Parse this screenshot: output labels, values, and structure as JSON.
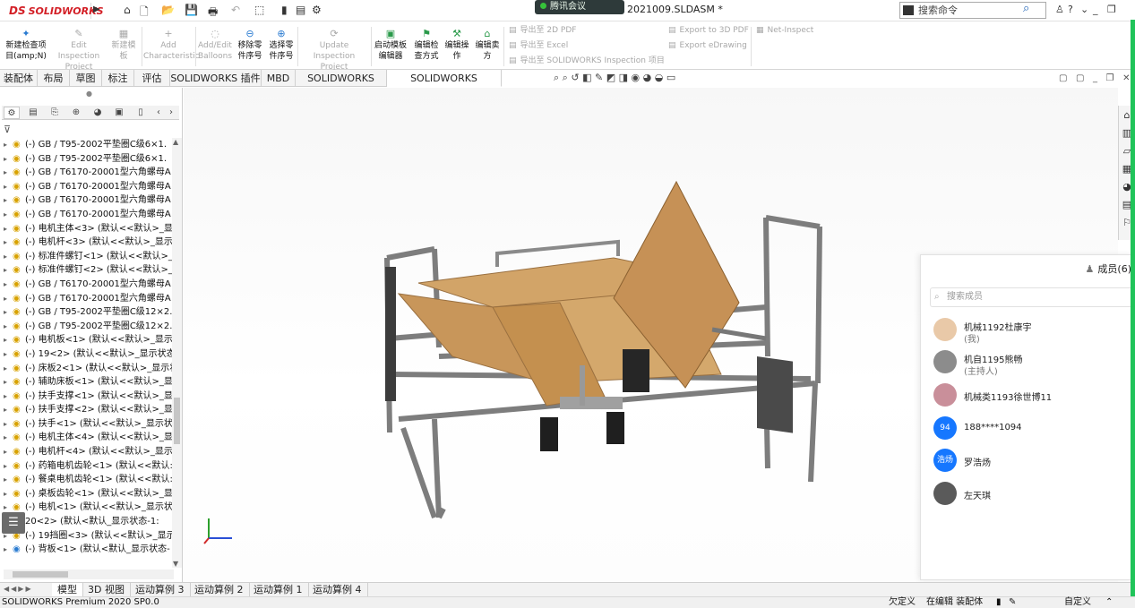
{
  "titlebar": {
    "app_logo_text": "SOLIDWORKS",
    "logo_prefix": "DS",
    "meeting_label": "腾讯会议",
    "document_title": "2021009.SLDASM *",
    "search_placeholder": "搜索命令",
    "help_label": "?"
  },
  "ribbon": {
    "buttons": [
      {
        "label": "新建检查项目(amp;N)",
        "enabled": true
      },
      {
        "label": "Edit Inspection Project",
        "enabled": false
      },
      {
        "label": "新建模板",
        "enabled": false
      },
      {
        "label": "Add Characteristic",
        "enabled": false
      },
      {
        "label": "Add/Edit Balloons",
        "enabled": false
      },
      {
        "label": "移除零件序号",
        "enabled": true
      },
      {
        "label": "选择零件序号",
        "enabled": true
      },
      {
        "label": "Update Inspection Project",
        "enabled": false
      },
      {
        "label": "启动模板编辑器",
        "enabled": true
      },
      {
        "label": "编辑检查方式",
        "enabled": true
      },
      {
        "label": "编辑操作",
        "enabled": true
      },
      {
        "label": "编辑卖方",
        "enabled": true
      }
    ],
    "export_items": [
      "导出至 2D PDF",
      "导出至 Excel",
      "导出至 SOLIDWORKS Inspection 项目",
      "Export to 3D PDF",
      "Export eDrawing",
      "Net-Inspect"
    ]
  },
  "tabs": [
    "装配体",
    "布局",
    "草图",
    "标注",
    "评估",
    "SOLIDWORKS 插件",
    "MBD",
    "SOLIDWORKS CAM",
    "SOLIDWORKS Inspection"
  ],
  "active_tab": "SOLIDWORKS Inspection",
  "tree": [
    {
      "text": "(-) GB / T95-2002平垫圈C级6×1.",
      "icon": "part"
    },
    {
      "text": "(-) GB / T95-2002平垫圈C级6×1.",
      "icon": "part"
    },
    {
      "text": "(-) GB / T6170-20001型六角螺母A",
      "icon": "part"
    },
    {
      "text": "(-) GB / T6170-20001型六角螺母A",
      "icon": "part"
    },
    {
      "text": "(-) GB / T6170-20001型六角螺母A",
      "icon": "part"
    },
    {
      "text": "(-) GB / T6170-20001型六角螺母A",
      "icon": "part"
    },
    {
      "text": "(-) 电机主体<3> (默认<<默认>_显",
      "icon": "part"
    },
    {
      "text": "(-) 电机杆<3> (默认<<默认>_显示",
      "icon": "part"
    },
    {
      "text": "(-) 标准件螺钉<1> (默认<<默认>_",
      "icon": "part"
    },
    {
      "text": "(-) 标准件螺钉<2> (默认<<默认>_",
      "icon": "part"
    },
    {
      "text": "(-) GB / T6170-20001型六角螺母A",
      "icon": "part"
    },
    {
      "text": "(-) GB / T6170-20001型六角螺母A",
      "icon": "part"
    },
    {
      "text": "(-) GB / T95-2002平垫圈C级12×2.",
      "icon": "part"
    },
    {
      "text": "(-) GB / T95-2002平垫圈C级12×2.",
      "icon": "part"
    },
    {
      "text": "(-) 电机板<1> (默认<<默认>_显示",
      "icon": "part"
    },
    {
      "text": "(-) 19<2> (默认<<默认>_显示状态",
      "icon": "part"
    },
    {
      "text": "(-) 床板2<1> (默认<<默认>_显示状",
      "icon": "part"
    },
    {
      "text": "(-) 辅助床板<1> (默认<<默认>_显",
      "icon": "part"
    },
    {
      "text": "(-) 扶手支撑<1> (默认<<默认>_显",
      "icon": "part"
    },
    {
      "text": "(-) 扶手支撑<2> (默认<<默认>_显",
      "icon": "part"
    },
    {
      "text": "(-) 扶手<1> (默认<<默认>_显示状",
      "icon": "part"
    },
    {
      "text": "(-) 电机主体<4> (默认<<默认>_显",
      "icon": "part"
    },
    {
      "text": "(-) 电机杆<4> (默认<<默认>_显示",
      "icon": "part"
    },
    {
      "text": "(-) 药箱电机齿轮<1> (默认<<默认:",
      "icon": "part"
    },
    {
      "text": "(-) 餐桌电机齿轮<1> (默认<<默认:",
      "icon": "part"
    },
    {
      "text": "(-) 桌板齿轮<1> (默认<<默认>_显",
      "icon": "part"
    },
    {
      "text": "(-) 电机<1> (默认<<默认>_显示状",
      "icon": "part"
    },
    {
      "text": "20<2> (默认<默认_显示状态-1:",
      "icon": "assembly"
    },
    {
      "text": "(-) 19挡圈<3> (默认<<默认>_显示",
      "icon": "part"
    },
    {
      "text": "(-) 背板<1> (默认<默认_显示状态-",
      "icon": "assembly"
    }
  ],
  "members": {
    "title": "成员(6)",
    "search_placeholder": "搜索成员",
    "list": [
      {
        "name": "机械1192杜康宇",
        "role": "(我)",
        "avatar_text": "",
        "avatar_color": "#e9c9a8"
      },
      {
        "name": "机自1195熊畅",
        "role": "(主持人)",
        "avatar_text": "",
        "avatar_color": "#8c8c8c"
      },
      {
        "name": "机械类1193徐世博11",
        "role": "",
        "avatar_text": "",
        "avatar_color": "#c98f9a"
      },
      {
        "name": "188****1094",
        "role": "",
        "avatar_text": "94",
        "avatar_color": "#1677ff"
      },
      {
        "name": "罗浩炀",
        "role": "",
        "avatar_text": "浩炀",
        "avatar_color": "#1677ff"
      },
      {
        "name": "左天琪",
        "role": "",
        "avatar_text": "",
        "avatar_color": "#5a5a5a"
      }
    ]
  },
  "bottom_tabs": [
    "模型",
    "3D 视图",
    "运动算例 3",
    "运动算例 2",
    "运动算例 1",
    "运动算例 4"
  ],
  "active_bottom_tab": "模型",
  "status": {
    "product": "SOLIDWORKS Premium 2020 SP0.0",
    "state": "欠定义",
    "editing": "在编辑 装配体",
    "custom": "自定义"
  },
  "colors": {
    "brand": "#d31f26",
    "accent_green": "#20c45a",
    "wood": "#c99a5a",
    "frame": "#8b8b8b"
  }
}
